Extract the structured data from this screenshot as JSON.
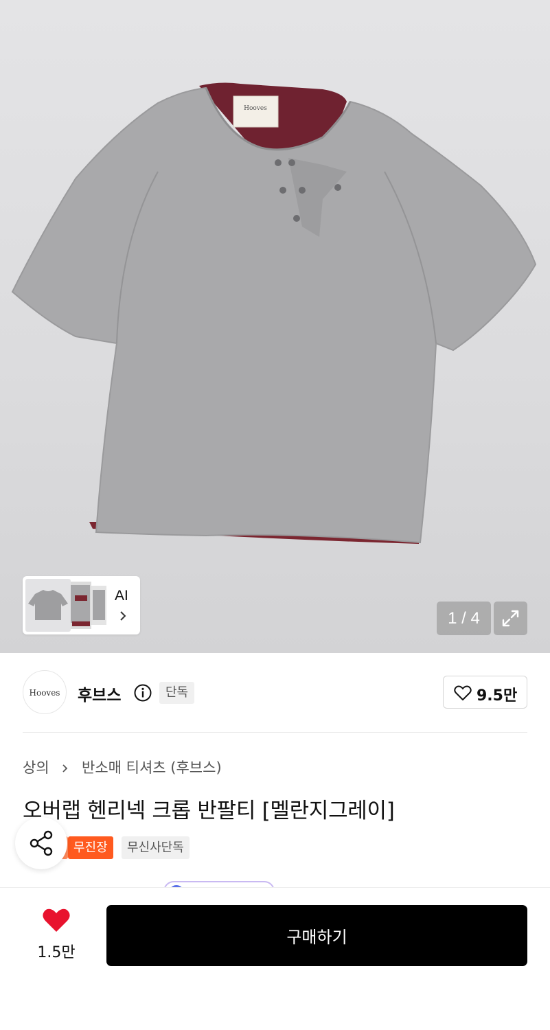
{
  "gallery": {
    "thumb_ai_label": "AI",
    "counter": "1 / 4",
    "product_logo_text": "Hooves"
  },
  "brand": {
    "logo_text": "Hooves",
    "name": "후브스",
    "exclusive_tag": "단독",
    "like_count": "9.5만"
  },
  "breadcrumb": {
    "level1": "상의",
    "level2": "반소매 티셔츠 (후브스)"
  },
  "product": {
    "title": "오버랩 헨리넥 크롭 반팔티 [멜란지그레이]",
    "badges": [
      "무진장",
      "무신사단독"
    ]
  },
  "bottom_bar": {
    "like_count": "1.5만",
    "buy_label": "구매하기"
  },
  "colors": {
    "accent_orange": "#ff5a1f",
    "heart_red": "#e8132e",
    "buy_button": "#000000"
  }
}
